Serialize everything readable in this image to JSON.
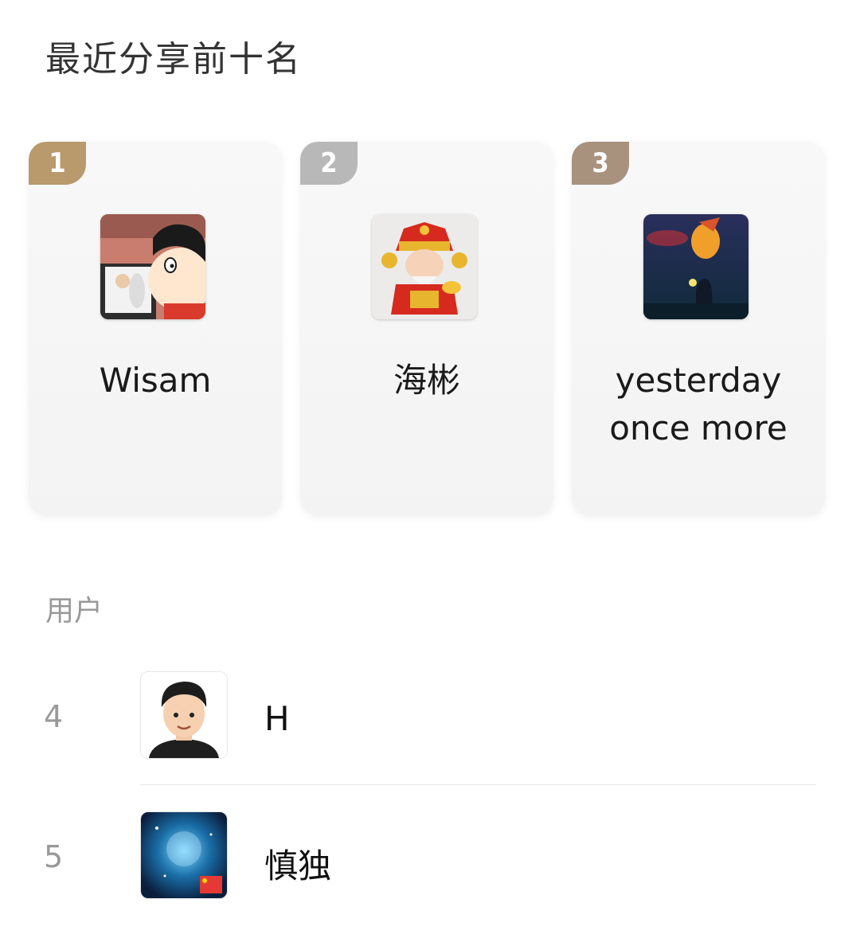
{
  "header": {
    "title": "最近分享前十名"
  },
  "top3": [
    {
      "rank": "1",
      "name": "Wisam",
      "badge_color": "#b89a6c",
      "avatar": "cartoon-avatar"
    },
    {
      "rank": "2",
      "name": "海彬",
      "badge_color": "#b8b8b8",
      "avatar": "god-of-wealth-avatar"
    },
    {
      "rank": "3",
      "name": "yesterday once more",
      "badge_color": "#a8927e",
      "avatar": "fish-cat-avatar"
    }
  ],
  "users_section": {
    "label": "用户"
  },
  "users": [
    {
      "rank": "4",
      "name": "H",
      "avatar": "cartoon-man-avatar"
    },
    {
      "rank": "5",
      "name": "慎独",
      "avatar": "galaxy-avatar"
    }
  ]
}
